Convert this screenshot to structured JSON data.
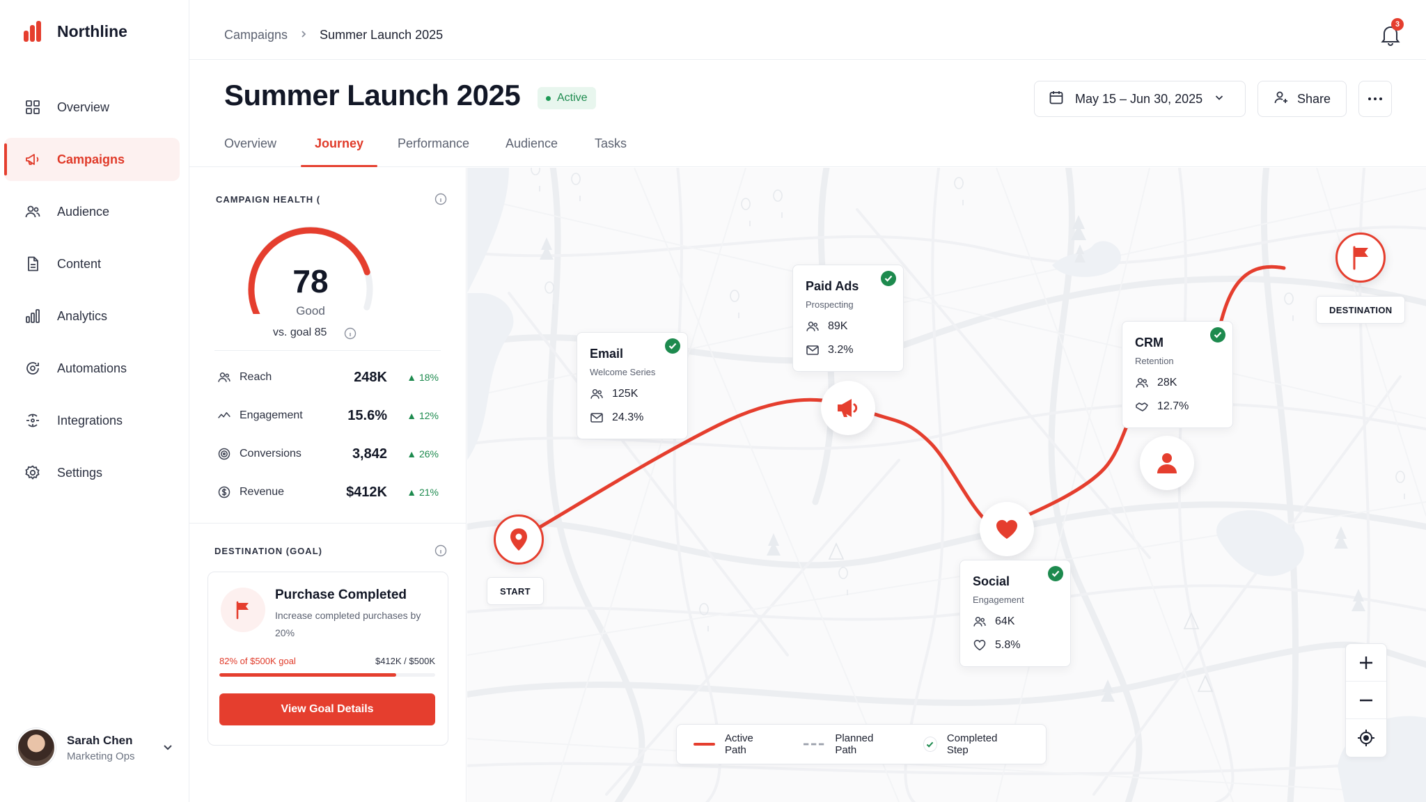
{
  "app": {
    "name": "Northline"
  },
  "sidebar": {
    "items": [
      {
        "label": "Overview",
        "icon": "grid-icon",
        "active": false
      },
      {
        "label": "Campaigns",
        "icon": "megaphone-icon",
        "active": true
      },
      {
        "label": "Audience",
        "icon": "users-icon",
        "active": false
      },
      {
        "label": "Content",
        "icon": "document-icon",
        "active": false
      },
      {
        "label": "Analytics",
        "icon": "bar-chart-icon",
        "active": false
      },
      {
        "label": "Automations",
        "icon": "automation-icon",
        "active": false
      },
      {
        "label": "Integrations",
        "icon": "integrations-icon",
        "active": false
      },
      {
        "label": "Settings",
        "icon": "gear-icon",
        "active": false
      }
    ]
  },
  "user": {
    "name": "Sarah Chen",
    "role": "Marketing Ops"
  },
  "breadcrumb": {
    "parent": "Campaigns",
    "current": "Summer Launch 2025"
  },
  "notifications": {
    "count": "3"
  },
  "page": {
    "title": "Summer Launch 2025",
    "status": "Active",
    "date_range": "May 15 – Jun 30, 2025",
    "share_label": "Share"
  },
  "tabs": [
    "Overview",
    "Journey",
    "Performance",
    "Audience",
    "Tasks"
  ],
  "active_tab": "Journey",
  "health": {
    "title": "CAMPAIGN HEALTH (",
    "score": "78",
    "score_fraction": 0.78,
    "rating": "Good",
    "goal_text": "vs. goal 85",
    "metrics": [
      {
        "label": "Reach",
        "value": "248K",
        "delta": "18%",
        "icon": "users-icon"
      },
      {
        "label": "Engagement",
        "value": "15.6%",
        "delta": "12%",
        "icon": "activity-icon"
      },
      {
        "label": "Conversions",
        "value": "3,842",
        "delta": "26%",
        "icon": "target-icon"
      },
      {
        "label": "Revenue",
        "value": "$412K",
        "delta": "21%",
        "icon": "dollar-icon"
      }
    ]
  },
  "goal": {
    "title": "DESTINATION (GOAL)",
    "name": "Purchase Completed",
    "description": "Increase completed purchases by 20%",
    "progress_text": "82% of $500K goal",
    "amount_text": "$412K / $500K",
    "progress": 0.82,
    "button": "View Goal Details"
  },
  "journey": {
    "start_label": "START",
    "destination_label": "DESTINATION",
    "steps": [
      {
        "name": "Email",
        "subtitle": "Welcome Series",
        "reach": "125K",
        "rate": "24.3%",
        "completed": true
      },
      {
        "name": "Paid Ads",
        "subtitle": "Prospecting",
        "reach": "89K",
        "rate": "3.2%",
        "completed": true
      },
      {
        "name": "Social",
        "subtitle": "Engagement",
        "reach": "64K",
        "rate": "5.8%",
        "completed": true
      },
      {
        "name": "CRM",
        "subtitle": "Retention",
        "reach": "28K",
        "rate": "12.7%",
        "completed": true
      }
    ]
  },
  "legend": {
    "active": "Active Path",
    "planned": "Planned Path",
    "completed": "Completed Step"
  },
  "colors": {
    "accent": "#e53e2e",
    "success": "#1d8a4e",
    "text": "#121726"
  }
}
